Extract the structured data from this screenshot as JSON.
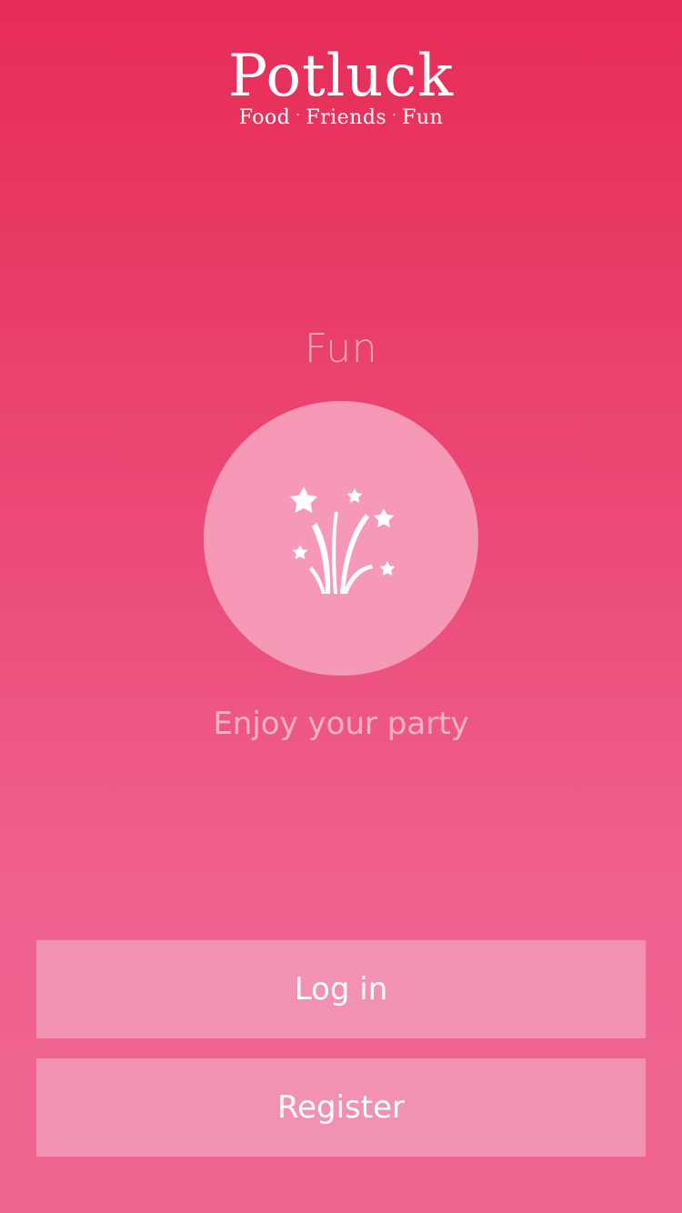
{
  "header": {
    "title": "Potluck",
    "tagline_parts": [
      "Food",
      "Friends",
      "Fun"
    ],
    "separator": "·"
  },
  "slide": {
    "title": "Fun",
    "icon": "fireworks-icon",
    "caption": "Enjoy your party"
  },
  "actions": {
    "login_label": "Log in",
    "register_label": "Register"
  },
  "colors": {
    "background_top": "#e62c56",
    "background_bottom": "#f06590",
    "circle": "#f599b6",
    "button": "#f391b2",
    "text": "#ffffff"
  }
}
